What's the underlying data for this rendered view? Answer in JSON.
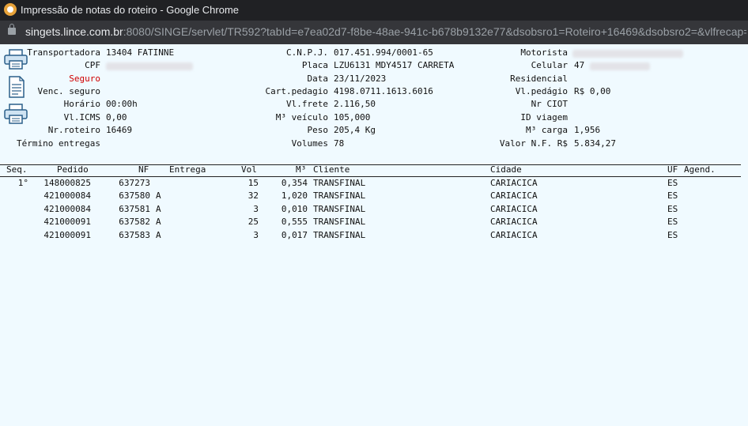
{
  "window": {
    "title": "Impressão de notas do roteiro - Google Chrome"
  },
  "address": {
    "host": "singets.lince.com.br",
    "rest": ":8080/SINGE/servlet/TR592?tabId=e7ea02d7-f8be-48ae-941c-b678b9132e77&dsobsro1=Roteiro+16469&dsobsro2=&vlfrecap="
  },
  "info": {
    "transportadora_label": "Transportadora",
    "transportadora": "13404 FATINNE",
    "cpf_label": "CPF",
    "seguro_label": "Seguro",
    "venc_label": "Venc. seguro",
    "horario_label": "Horário",
    "horario": "00:00h",
    "icms_label": "Vl.ICMS",
    "icms": "0,00",
    "nrroteiro_label": "Nr.roteiro",
    "nrroteiro": "16469",
    "termino_label": "Término entregas",
    "cnpj_label": "C.N.P.J.",
    "cnpj": "017.451.994/0001-65",
    "placa_label": "Placa",
    "placa": "LZU6131 MDY4517 CARRETA",
    "data_label": "Data",
    "data": "23/11/2023",
    "cartpedagio_label": "Cart.pedagio",
    "cartpedagio": "4198.0711.1613.6016",
    "vlfrete_label": "Vl.frete",
    "vlfrete": "2.116,50",
    "m3veiculo_label": "M³ veículo",
    "m3veiculo": "105,000",
    "peso_label": "Peso",
    "peso": "205,4 Kg",
    "volumes_label": "Volumes",
    "volumes": "78",
    "motorista_label": "Motorista",
    "celular_label": "Celular",
    "celular": "47",
    "residencial_label": "Residencial",
    "vlpedagio_label": "Vl.pedágio",
    "vlpedagio": "R$ 0,00",
    "nrciot_label": "Nr CIOT",
    "idviagem_label": "ID viagem",
    "m3carga_label": "M³ carga",
    "m3carga": "1,956",
    "valornf_label": "Valor N.F. R$",
    "valornf": "5.834,27"
  },
  "table": {
    "headers": {
      "seq": "Seq.",
      "pedido": "Pedido",
      "nf": "NF",
      "entrega": "Entrega",
      "vol": "Vol",
      "m3": "M³",
      "cliente": "Cliente",
      "cidade": "Cidade",
      "uf": "UF",
      "agend": "Agend."
    },
    "rows": [
      {
        "seq": "1°",
        "pedido": "148000825",
        "nf": "637273",
        "flag": "",
        "vol": "15",
        "m3": "0,354",
        "cliente": "TRANSFINAL",
        "cidade": "CARIACICA",
        "uf": "ES"
      },
      {
        "seq": "",
        "pedido": "421000084",
        "nf": "637580",
        "flag": "A",
        "vol": "32",
        "m3": "1,020",
        "cliente": "TRANSFINAL",
        "cidade": "CARIACICA",
        "uf": "ES"
      },
      {
        "seq": "",
        "pedido": "421000084",
        "nf": "637581",
        "flag": "A",
        "vol": "3",
        "m3": "0,010",
        "cliente": "TRANSFINAL",
        "cidade": "CARIACICA",
        "uf": "ES"
      },
      {
        "seq": "",
        "pedido": "421000091",
        "nf": "637582",
        "flag": "A",
        "vol": "25",
        "m3": "0,555",
        "cliente": "TRANSFINAL",
        "cidade": "CARIACICA",
        "uf": "ES"
      },
      {
        "seq": "",
        "pedido": "421000091",
        "nf": "637583",
        "flag": "A",
        "vol": "3",
        "m3": "0,017",
        "cliente": "TRANSFINAL",
        "cidade": "CARIACICA",
        "uf": "ES"
      }
    ]
  },
  "icons": [
    "printer-icon",
    "document-icon",
    "printer-icon"
  ],
  "colors": {
    "background": "#f0faff",
    "seguro_label": "#d00000"
  }
}
